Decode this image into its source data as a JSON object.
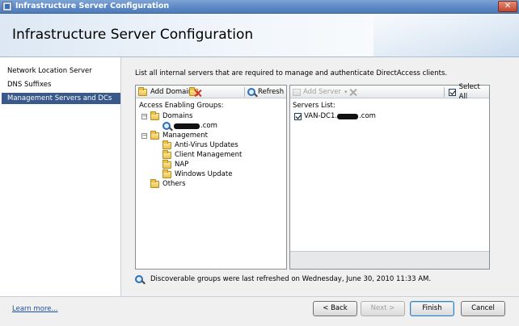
{
  "window": {
    "title": "Infrastructure Server Configuration",
    "close_label": "✕"
  },
  "header": {
    "title": "Infrastructure Server Configuration"
  },
  "nav": {
    "items": [
      {
        "label": "Network Location Server"
      },
      {
        "label": "DNS Suffixes"
      },
      {
        "label": "Management Servers and DCs"
      }
    ]
  },
  "main": {
    "description": "List all internal servers that are required to manage and authenticate DirectAccess clients.",
    "left_panel": {
      "add_domain_label": "Add Domain",
      "refresh_label": "Refresh",
      "groups_header": "Access Enabling Groups:",
      "domains_label": "Domains",
      "domain_entry_suffix": ".com",
      "management_label": "Management",
      "management_children": [
        {
          "label": "Anti-Virus Updates"
        },
        {
          "label": "Client Management"
        },
        {
          "label": "NAP"
        },
        {
          "label": "Windows Update"
        }
      ],
      "others_label": "Others"
    },
    "right_panel": {
      "add_server_label": "Add Server",
      "select_all_label": "Select All",
      "servers_header": "Servers List:",
      "server_prefix": "VAN-DC1.",
      "server_suffix": ".com"
    },
    "refresh_info": "Discoverable groups were last refreshed on Wednesday, June 30, 2010 11:33 AM."
  },
  "footer": {
    "learn_more": "Learn more...",
    "back_label": "< Back",
    "next_label": "Next >",
    "finish_label": "Finish",
    "cancel_label": "Cancel"
  }
}
